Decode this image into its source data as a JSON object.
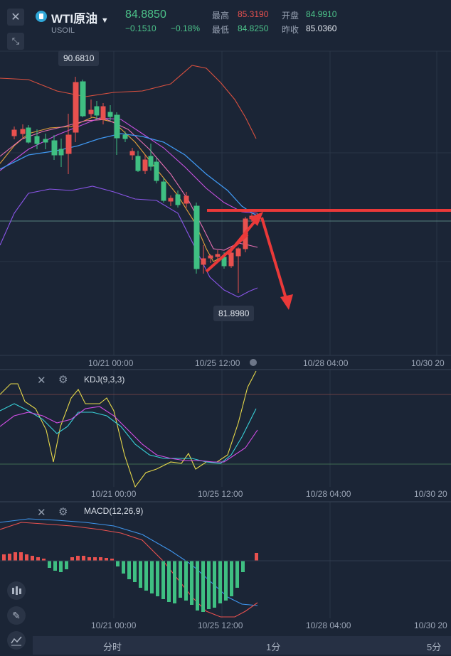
{
  "header": {
    "symbol": "WTI原油",
    "code": "USOIL",
    "price": "84.8850",
    "change": "−0.1510",
    "change_pct": "−0.18%",
    "high_label": "最高",
    "high": "85.3190",
    "low_label": "最低",
    "low": "84.8250",
    "open_label": "开盘",
    "open": "84.9910",
    "prev_label": "昨收",
    "prev": "85.0360"
  },
  "main": {
    "max_label": "90.6810",
    "min_label": "81.8980",
    "x_ticks": [
      "10/21 00:00",
      "10/25 12:00",
      "10/28 04:00",
      "10/30 20"
    ]
  },
  "kdj": {
    "title": "KDJ(9,3,3)",
    "x_ticks": [
      "10/21 00:00",
      "10/25 12:00",
      "10/28 04:00",
      "10/30 20"
    ]
  },
  "macd": {
    "title": "MACD(12,26,9)",
    "x_ticks": [
      "10/21 00:00",
      "10/25 12:00",
      "10/28 04:00",
      "10/30 20"
    ]
  },
  "tabs": [
    "分时",
    "1分",
    "5分"
  ],
  "colors": {
    "up": "#e8514f",
    "down": "#3fbf82",
    "accent": "#ea3939"
  }
}
